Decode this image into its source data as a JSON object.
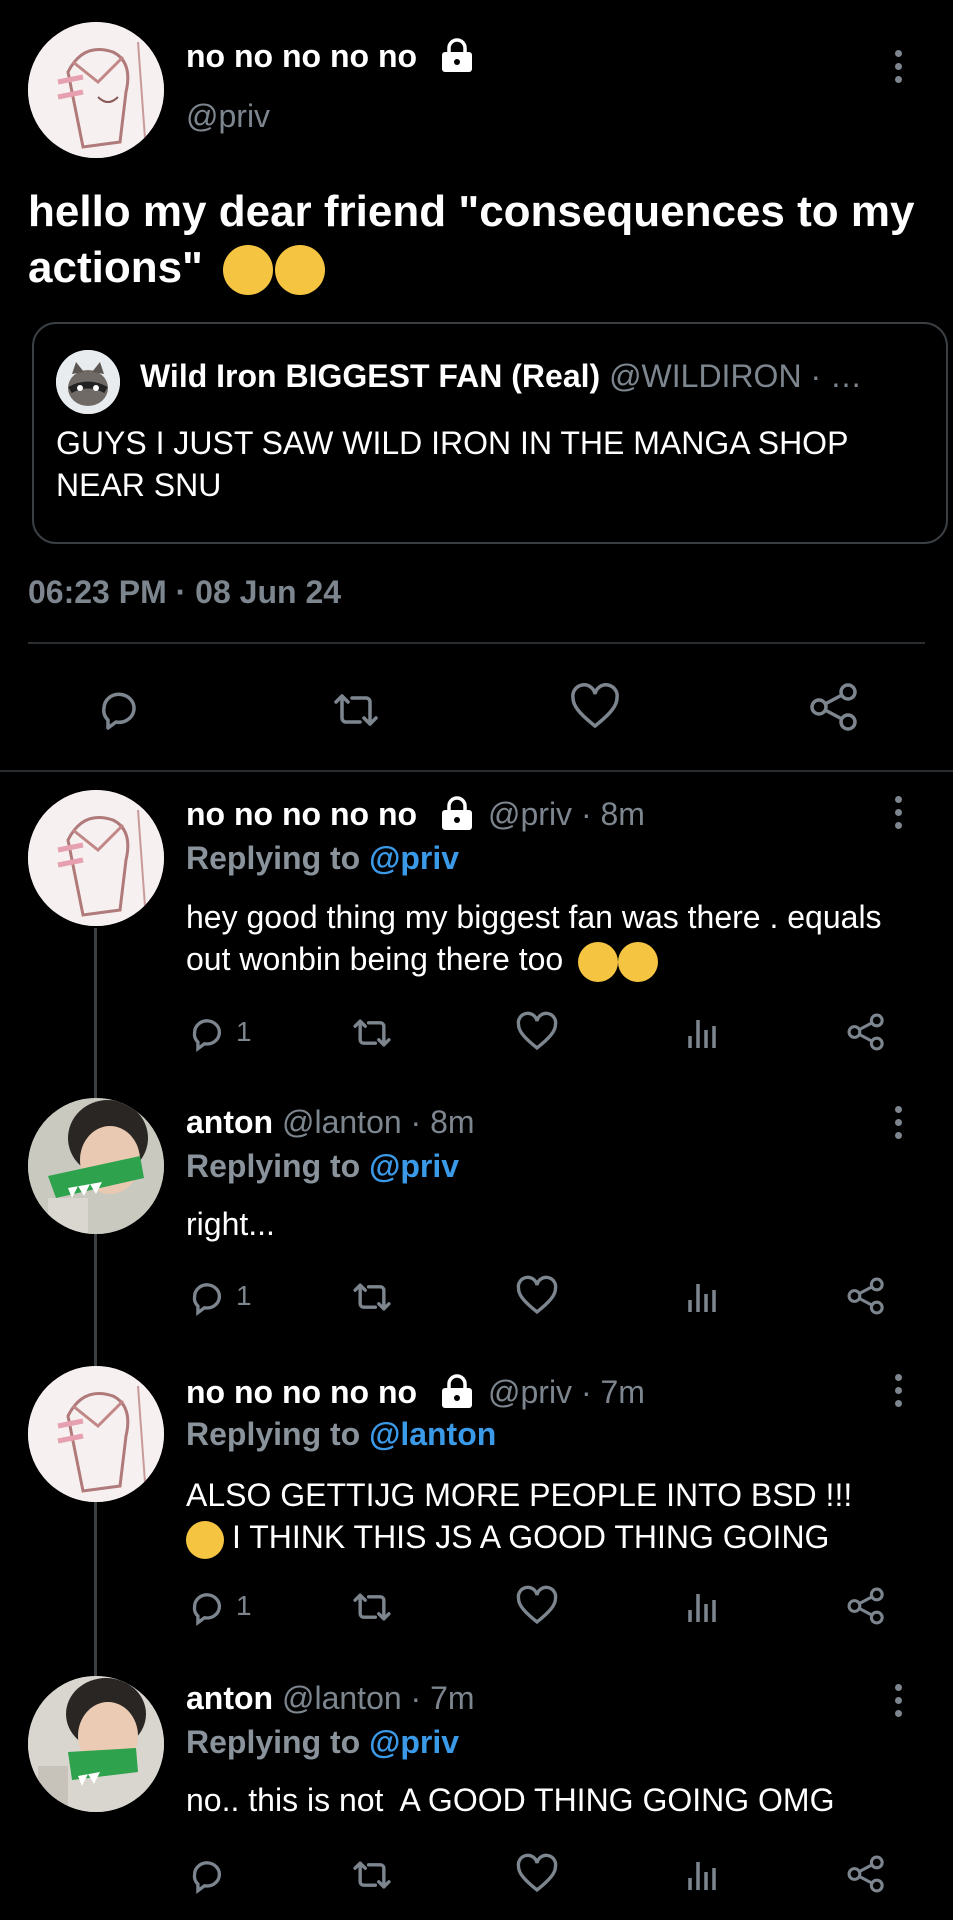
{
  "main_tweet": {
    "display_name": "no no no no no",
    "handle": "@priv",
    "text": "hello my dear friend \"consequences to my actions\"",
    "emoji": "🙄🙄",
    "quote": {
      "display_name": "Wild Iron BIGGEST FAN (Real)",
      "handle": "@WILDIRON",
      "separator": "· …",
      "text": "GUYS I JUST SAW WILD IRON IN THE MANGA SHOP NEAR SNU"
    },
    "timestamp": "06:23 PM · 08 Jun 24"
  },
  "replies": [
    {
      "display_name": "no no no no no",
      "handle_time": "@priv · 8m",
      "replying_label": "Replying to",
      "replying_handle": "@priv",
      "text": "hey good thing my biggest fan was there . equals out wonbin being there too",
      "emoji": "🤪🤪",
      "reply_count": "1"
    },
    {
      "display_name": "anton",
      "handle_time": "@lanton · 8m",
      "replying_label": "Replying to",
      "replying_handle": "@priv",
      "text": "right...",
      "emoji": "",
      "reply_count": "1"
    },
    {
      "display_name": "no no no no no",
      "handle_time": "@priv · 7m",
      "replying_label": "Replying to",
      "replying_handle": "@lanton",
      "text_line1": "ALSO GETTIJG MORE PEOPLE INTO BSD !!!",
      "emoji": "🥳",
      "text_line2": "I THINK THIS JS A GOOD THING GOING",
      "reply_count": "1"
    },
    {
      "display_name": "anton",
      "handle_time": "@lanton · 7m",
      "replying_label": "Replying to",
      "replying_handle": "@priv",
      "text": "no.. this is not  A GOOD THING GOING OMG",
      "emoji": "",
      "reply_count": ""
    }
  ],
  "colors": {
    "background": "#000000",
    "text": "#ffffff",
    "secondary": "#7d868f",
    "link": "#3b9ae8"
  }
}
